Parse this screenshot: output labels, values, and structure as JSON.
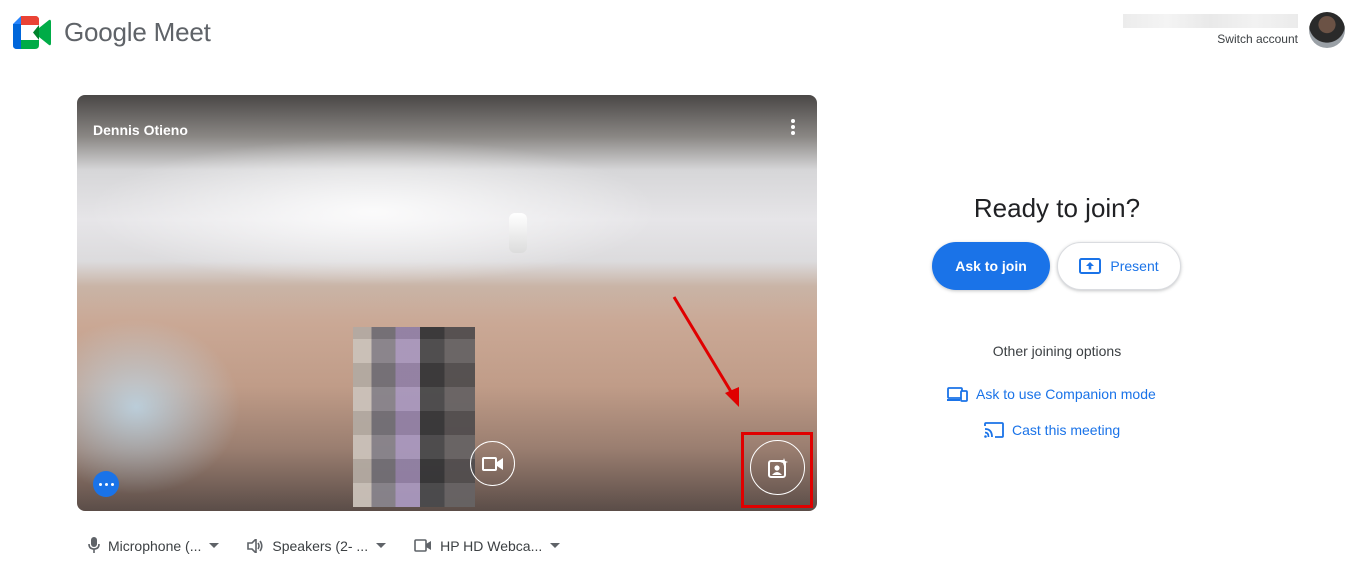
{
  "header": {
    "logo_text": "Google Meet",
    "switch_account_label": "Switch account"
  },
  "video_preview": {
    "participant_name": "Dennis Otieno"
  },
  "devices": {
    "microphone_label": "Microphone (...",
    "speakers_label": "Speakers (2- ...",
    "camera_label": "HP HD Webca..."
  },
  "join_panel": {
    "title": "Ready to join?",
    "ask_to_join_label": "Ask to join",
    "present_label": "Present",
    "other_options_label": "Other joining options",
    "companion_mode_label": "Ask to use Companion mode",
    "cast_label": "Cast this meeting"
  },
  "colors": {
    "accent": "#1a73e8",
    "highlight": "#e00000"
  },
  "icons": [
    "meet-logo-icon",
    "avatar",
    "more-vert-icon",
    "videocam-icon",
    "visual-effects-icon",
    "more-horiz-icon",
    "mic-icon",
    "speaker-icon",
    "camera-icon",
    "present-icon",
    "companion-icon",
    "cast-icon"
  ]
}
